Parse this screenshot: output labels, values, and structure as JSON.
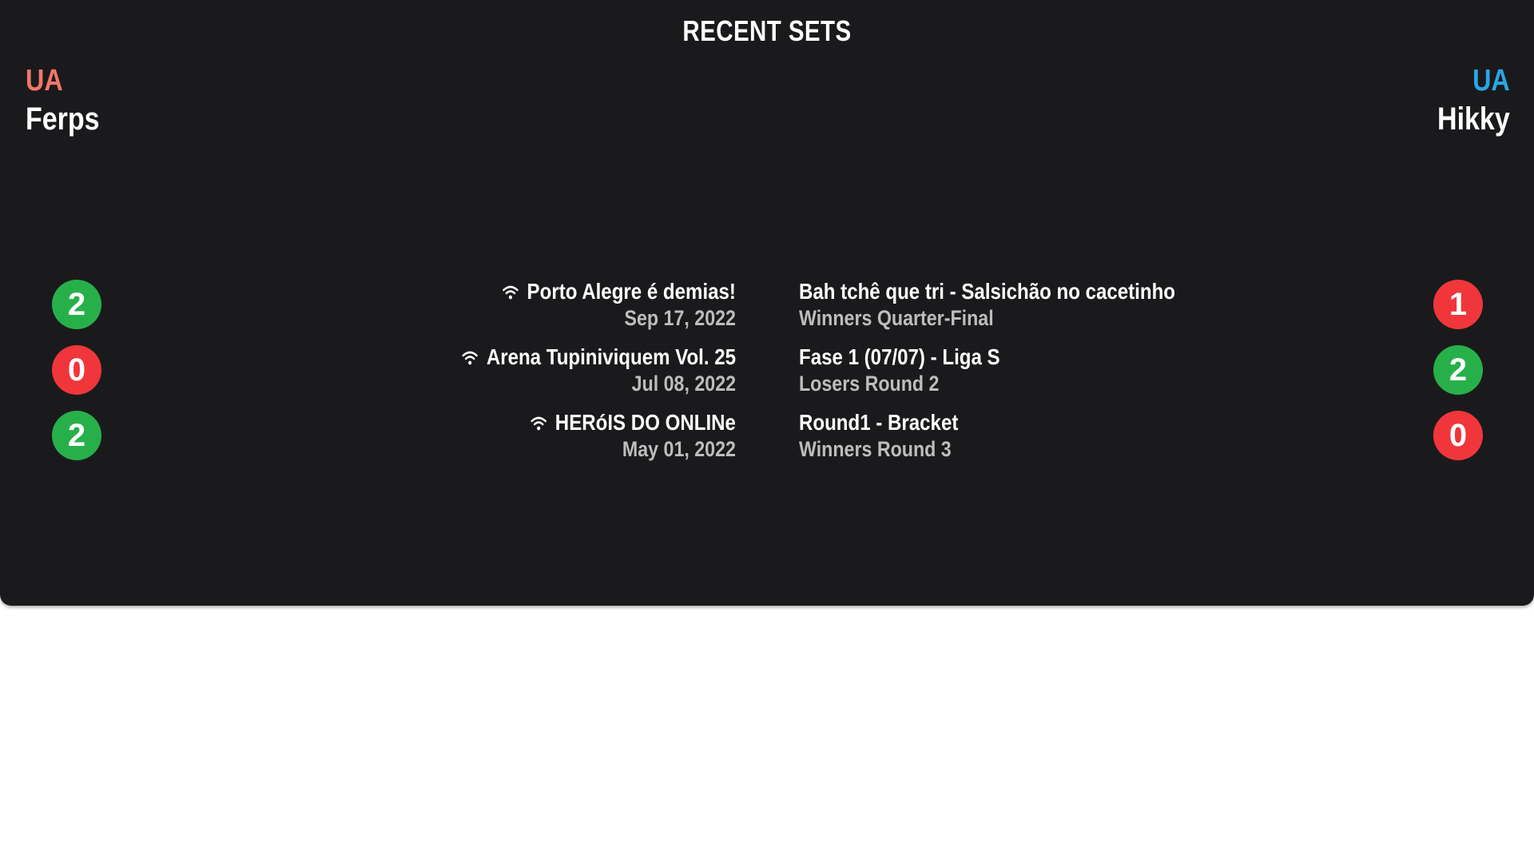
{
  "title": "RECENT SETS",
  "player1": {
    "country": "UA",
    "name": "Ferps",
    "country_color": "#f2776a"
  },
  "player2": {
    "country": "UA",
    "name": "Hikky",
    "country_color": "#2ba6e8"
  },
  "colors": {
    "win": "#27b04a",
    "loss": "#f0363b",
    "background": "#1a1a1c"
  },
  "sets": [
    {
      "p1_score": "2",
      "p1_result": "win",
      "p2_score": "1",
      "p2_result": "loss",
      "tournament": "Porto Alegre é demias!",
      "online_icon": "wifi-icon",
      "date": "Sep 17, 2022",
      "event": "Bah tchê que tri - Salsichão no cacetinho",
      "round": "Winners Quarter-Final"
    },
    {
      "p1_score": "0",
      "p1_result": "loss",
      "p2_score": "2",
      "p2_result": "win",
      "tournament": "Arena Tupiniviquem Vol. 25",
      "online_icon": "wifi-icon",
      "date": "Jul 08, 2022",
      "event": "Fase 1 (07/07) - Liga S",
      "round": "Losers Round 2"
    },
    {
      "p1_score": "2",
      "p1_result": "win",
      "p2_score": "0",
      "p2_result": "loss",
      "tournament": "HERóIS DO ONLINe",
      "online_icon": "wifi-icon",
      "date": "May 01, 2022",
      "event": "Round1 - Bracket",
      "round": "Winners Round 3"
    }
  ]
}
